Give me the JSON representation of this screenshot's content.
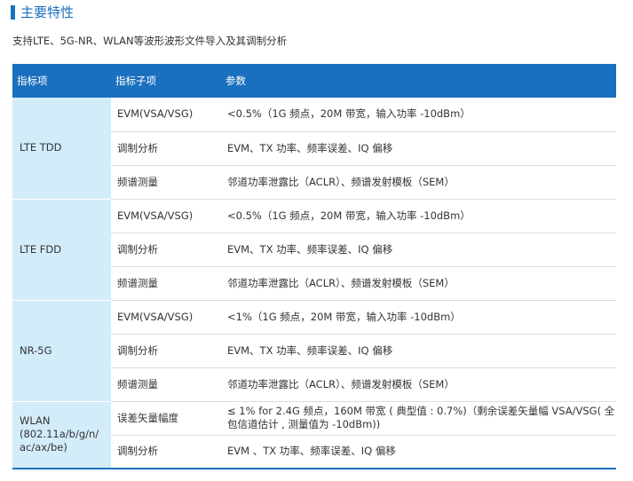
{
  "section": {
    "title": "主要特性",
    "intro": "支持LTE、5G-NR、WLAN等波形波形文件导入及其调制分析"
  },
  "table": {
    "headers": [
      "指标项",
      "指标子项",
      "参数"
    ],
    "groups": [
      {
        "category": "LTE TDD",
        "rows": [
          {
            "sub": "EVM(VSA/VSG)",
            "value": "<0.5%（1G 频点，20M 带宽，输入功率 -10dBm）"
          },
          {
            "sub": "调制分析",
            "value": "EVM、TX 功率、频率误差、IQ 偏移"
          },
          {
            "sub": "频谱测量",
            "value": "邻道功率泄露比（ACLR）、频谱发射模板（SEM）"
          }
        ]
      },
      {
        "category": "LTE FDD",
        "rows": [
          {
            "sub": "EVM(VSA/VSG)",
            "value": "<0.5%（1G 频点，20M 带宽，输入功率 -10dBm）"
          },
          {
            "sub": "调制分析",
            "value": "EVM、TX 功率、频率误差、IQ 偏移"
          },
          {
            "sub": "频谱测量",
            "value": "邻道功率泄露比（ACLR）、频谱发射模板（SEM）"
          }
        ]
      },
      {
        "category": "NR-5G",
        "rows": [
          {
            "sub": "EVM(VSA/VSG)",
            "value": "<1%（1G 频点，20M 带宽，输入功率 -10dBm）"
          },
          {
            "sub": "调制分析",
            "value": "EVM、TX 功率、频率误差、IQ 偏移"
          },
          {
            "sub": "频谱测量",
            "value": "邻道功率泄露比（ACLR）、频谱发射模板（SEM）"
          }
        ]
      },
      {
        "category": "WLAN (802.11a/b/g/n/ ac/ax/be)",
        "rows": [
          {
            "sub": "误差矢量幅度",
            "value": "≤ 1% for 2.4G 频点，160M 带宽 ( 典型值 : 0.7%)（剩余误差矢量幅 VSA/VSG( 全包信道估计 , 测量值为 -10dBm))"
          },
          {
            "sub": "调制分析",
            "value": "EVM 、TX 功率、频率误差、IQ 偏移"
          }
        ]
      }
    ]
  },
  "colors": {
    "accent": "#1a6fbf",
    "category_bg": "#d3ecfa"
  }
}
